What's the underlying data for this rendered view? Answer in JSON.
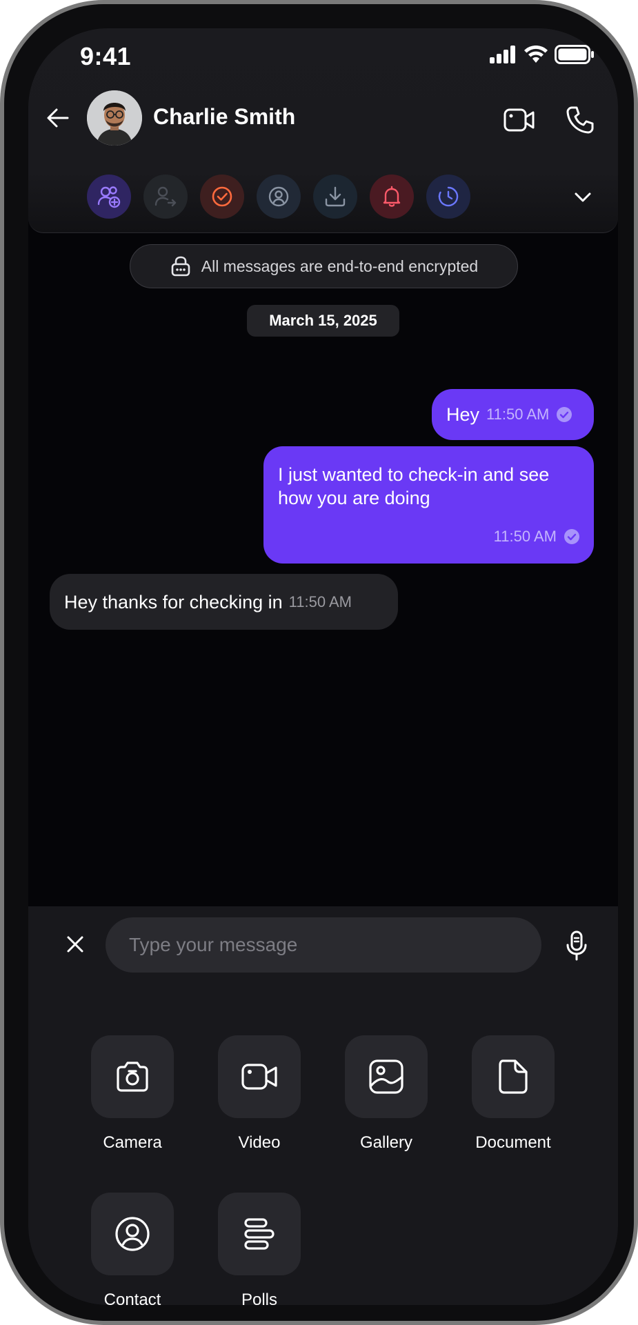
{
  "status_bar": {
    "time": "9:41",
    "icons": [
      "signal-icon",
      "wifi-icon",
      "battery-icon"
    ]
  },
  "header": {
    "contact_name": "Charlie Smith",
    "actions": [
      {
        "name": "add-group-icon",
        "bg": "#2f2562",
        "color": "#9a7bff"
      },
      {
        "name": "transfer-user-icon",
        "bg": "#23262a",
        "color": "#4b4f57"
      },
      {
        "name": "check-circle-icon",
        "bg": "#3e1f1f",
        "color": "#ff6a3d"
      },
      {
        "name": "contact-profile-icon",
        "bg": "#212936",
        "color": "#8a94a3"
      },
      {
        "name": "download-icon",
        "bg": "#1c2631",
        "color": "#8a94a3"
      },
      {
        "name": "bell-icon",
        "bg": "#4a1a22",
        "color": "#ff5a6a"
      },
      {
        "name": "clock-timer-icon",
        "bg": "#1f2543",
        "color": "#6b78ff"
      }
    ]
  },
  "encryption_notice": "All messages are end-to-end encrypted",
  "date_label": "March 15, 2025",
  "messages": [
    {
      "direction": "out",
      "text": "Hey",
      "time": "11:50 AM"
    },
    {
      "direction": "out",
      "text": "I just wanted to check-in and see how you are doing",
      "time": "11:50 AM"
    },
    {
      "direction": "in",
      "text": "Hey thanks for checking in",
      "time": "11:50 AM"
    }
  ],
  "composer": {
    "placeholder": "Type your message",
    "attachments": [
      {
        "label": "Camera",
        "icon": "camera-icon"
      },
      {
        "label": "Video",
        "icon": "video-icon"
      },
      {
        "label": "Gallery",
        "icon": "gallery-icon"
      },
      {
        "label": "Document",
        "icon": "document-icon"
      },
      {
        "label": "Contact",
        "icon": "contact-icon"
      },
      {
        "label": "Polls",
        "icon": "polls-icon"
      }
    ]
  },
  "colors": {
    "accent": "#6a39f5",
    "background": "#050508",
    "panel": "#18181c"
  }
}
